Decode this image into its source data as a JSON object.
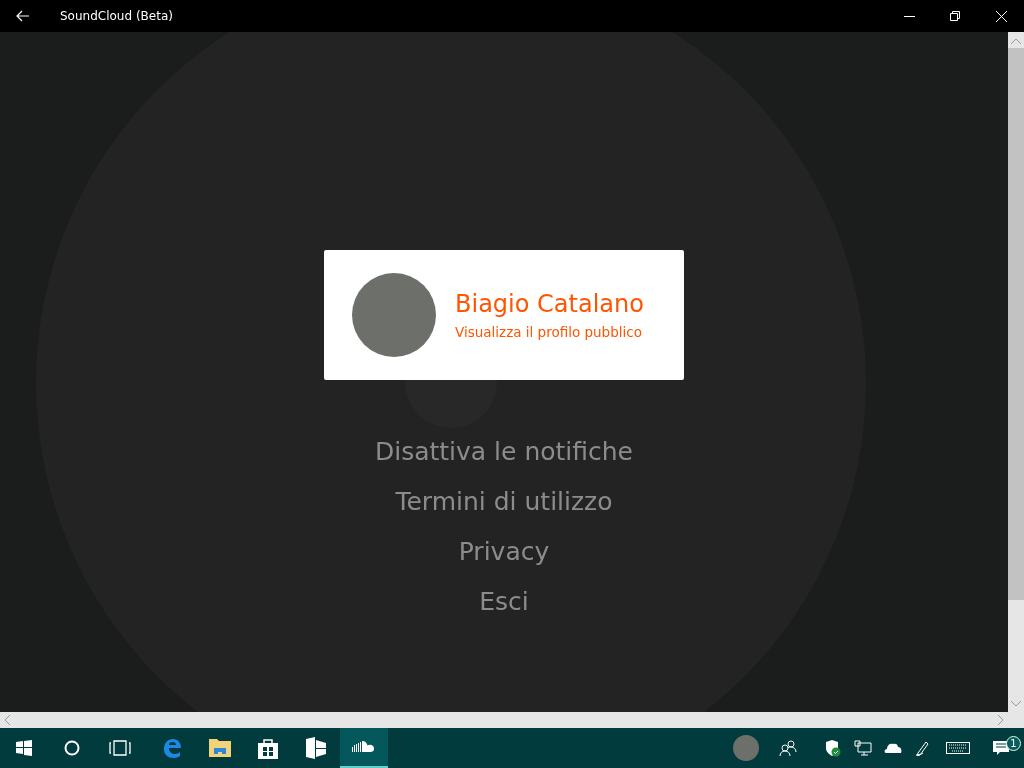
{
  "window": {
    "title": "SoundCloud (Beta)"
  },
  "profile": {
    "name": "Biagio Catalano",
    "link": "Visualizza il profilo pubblico"
  },
  "menu": [
    "Disattiva le notifiche",
    "Termini di utilizzo",
    "Privacy",
    "Esci"
  ],
  "taskbar": {
    "apps": [
      {
        "kind": "edge",
        "selected": false
      },
      {
        "kind": "explorer",
        "selected": false
      },
      {
        "kind": "store",
        "selected": false
      },
      {
        "kind": "flipboard",
        "selected": false
      },
      {
        "kind": "soundcloud",
        "selected": true
      }
    ],
    "notification_count": "1"
  }
}
